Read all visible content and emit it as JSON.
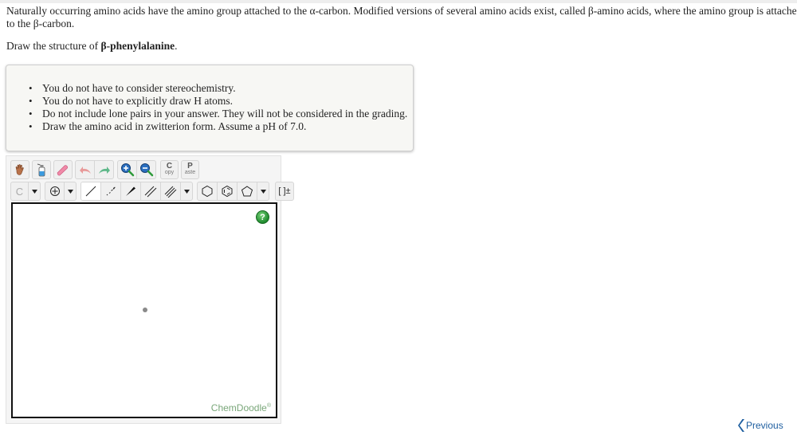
{
  "question": {
    "intro": "Naturally occurring amino acids have the amino group attached to the α-carbon. Modified versions of several amino acids exist, called β-amino acids, where the amino group is attached to the β-carbon.",
    "prompt_prefix": "Draw the structure of ",
    "prompt_target": "β-phenylalanine",
    "prompt_suffix": "."
  },
  "notes": [
    "You do not have to consider stereochemistry.",
    "You do not have to explicitly draw H atoms.",
    "Do not include lone pairs in your answer. They will not be considered in the grading.",
    "Draw the amino acid in zwitterion form. Assume a pH of 7.0."
  ],
  "editor": {
    "toolbar_row1": [
      {
        "name": "pan-tool",
        "icon": "hand-icon"
      },
      {
        "name": "clear-tool",
        "icon": "spray-bottle-icon"
      },
      {
        "name": "erase-tool",
        "icon": "eraser-icon"
      },
      {
        "name": "undo",
        "icon": "undo-icon"
      },
      {
        "name": "redo",
        "icon": "redo-icon"
      },
      {
        "name": "zoom-in",
        "icon": "zoom-in-icon"
      },
      {
        "name": "zoom-out",
        "icon": "zoom-out-icon"
      }
    ],
    "copy": {
      "big": "C",
      "small": "opy"
    },
    "paste": {
      "big": "P",
      "small": "aste"
    },
    "atom_label": "C",
    "charge_label": "[ ]±",
    "brand": "ChemDoodle",
    "brand_mark": "®",
    "help_label": "?",
    "colors": {
      "help": "#1e8a2e",
      "brand": "#7aa77a"
    }
  },
  "nav": {
    "previous_label": "Previous",
    "color": "#1f5fa0"
  }
}
